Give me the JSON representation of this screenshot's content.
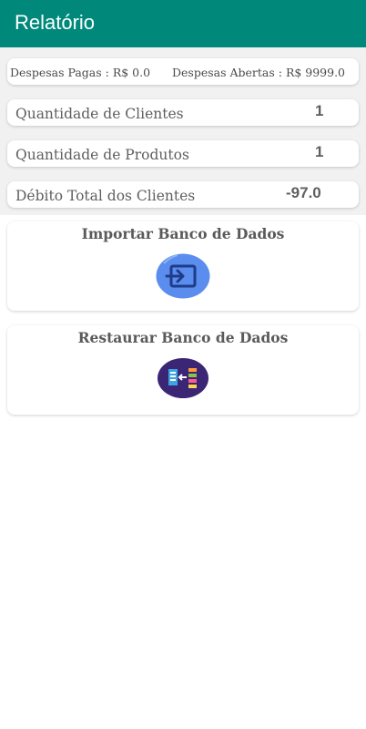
{
  "app_bar": {
    "title": "Relatório"
  },
  "summary": {
    "paid_expenses": "Despesas Pagas : R$ 0.0",
    "open_expenses": "Despesas Abertas : R$ 9999.0"
  },
  "stats": {
    "clients_label": "Quantidade de Clientes",
    "clients_value": "1",
    "products_label": "Quantidade de Produtos",
    "products_value": "1",
    "debt_label": "Débito Total dos Clientes",
    "debt_value": "-97.0"
  },
  "actions": {
    "import_title": "Importar Banco de Dados",
    "import_icon": "import-icon",
    "restore_title": "Restaurar Banco de Dados",
    "restore_icon": "restore-icon"
  },
  "colors": {
    "app_bar": "#00897b",
    "import_icon_bg": "#5b8def",
    "restore_icon_bg": "#3b2575"
  }
}
